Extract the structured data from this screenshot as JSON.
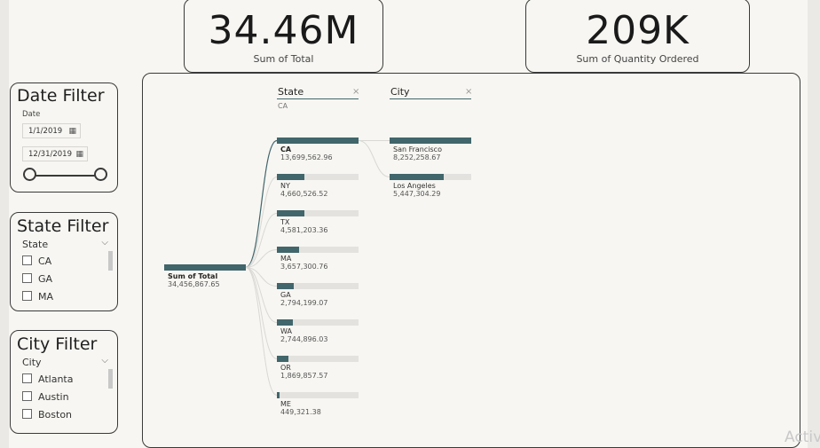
{
  "kpis": {
    "total": {
      "value": "34.46M",
      "label": "Sum of Total"
    },
    "quantity": {
      "value": "209K",
      "label": "Sum of Quantity Ordered"
    }
  },
  "date_filter": {
    "title": "Date Filter",
    "field_label": "Date",
    "start": "1/1/2019",
    "end": "12/31/2019",
    "range_min": 0,
    "range_max": 1
  },
  "state_filter": {
    "title": "State Filter",
    "header": "State",
    "options": [
      "CA",
      "GA",
      "MA"
    ]
  },
  "city_filter": {
    "title": "City Filter",
    "header": "City",
    "options": [
      "Atlanta",
      "Austin",
      "Boston"
    ]
  },
  "tree": {
    "state_header": "State",
    "state_selected": "CA",
    "city_header": "City",
    "close_glyph": "×",
    "root": {
      "label": "Sum of Total",
      "value": "34,456,867.65",
      "fraction": 1
    },
    "states": [
      {
        "label": "CA",
        "value": "13,699,562.96",
        "fraction": 1
      },
      {
        "label": "NY",
        "value": "4,660,526.52",
        "fraction": 0.34
      },
      {
        "label": "TX",
        "value": "4,581,203.36",
        "fraction": 0.334
      },
      {
        "label": "MA",
        "value": "3,657,300.76",
        "fraction": 0.267
      },
      {
        "label": "GA",
        "value": "2,794,199.07",
        "fraction": 0.204
      },
      {
        "label": "WA",
        "value": "2,744,896.03",
        "fraction": 0.2
      },
      {
        "label": "OR",
        "value": "1,869,857.57",
        "fraction": 0.136
      },
      {
        "label": "ME",
        "value": "449,321.38",
        "fraction": 0.033
      }
    ],
    "cities": [
      {
        "label": "San Francisco",
        "value": "8,252,258.67",
        "fraction": 1
      },
      {
        "label": "Los Angeles",
        "value": "5,447,304.29",
        "fraction": 0.66
      }
    ]
  },
  "watermark": "Activ",
  "colors": {
    "accent": "#41666b",
    "bar_bg": "#e3e2df",
    "canvas": "#f7f6f2"
  }
}
